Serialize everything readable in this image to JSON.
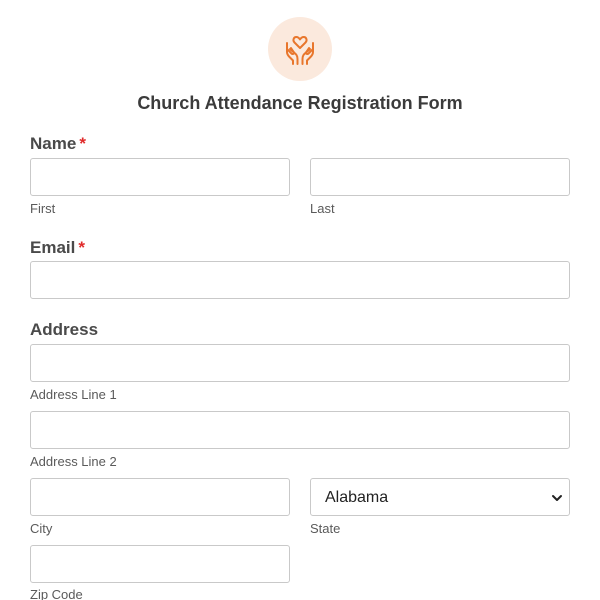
{
  "form": {
    "title": "Church Attendance Registration Form",
    "logo_icon": "heart-in-hands-icon",
    "accent_color": "#e8762c",
    "logo_bg_color": "#fbe9dd",
    "required_color": "#e02a2a"
  },
  "name": {
    "label": "Name",
    "required_mark": "*",
    "first": {
      "value": "",
      "sublabel": "First"
    },
    "last": {
      "value": "",
      "sublabel": "Last"
    }
  },
  "email": {
    "label": "Email",
    "required_mark": "*",
    "value": ""
  },
  "address": {
    "label": "Address",
    "line1": {
      "value": "",
      "sublabel": "Address Line 1"
    },
    "line2": {
      "value": "",
      "sublabel": "Address Line 2"
    },
    "city": {
      "value": "",
      "sublabel": "City"
    },
    "state": {
      "value": "Alabama",
      "sublabel": "State",
      "icon": "chevron-down-icon"
    },
    "zip": {
      "value": "",
      "sublabel": "Zip Code"
    }
  }
}
